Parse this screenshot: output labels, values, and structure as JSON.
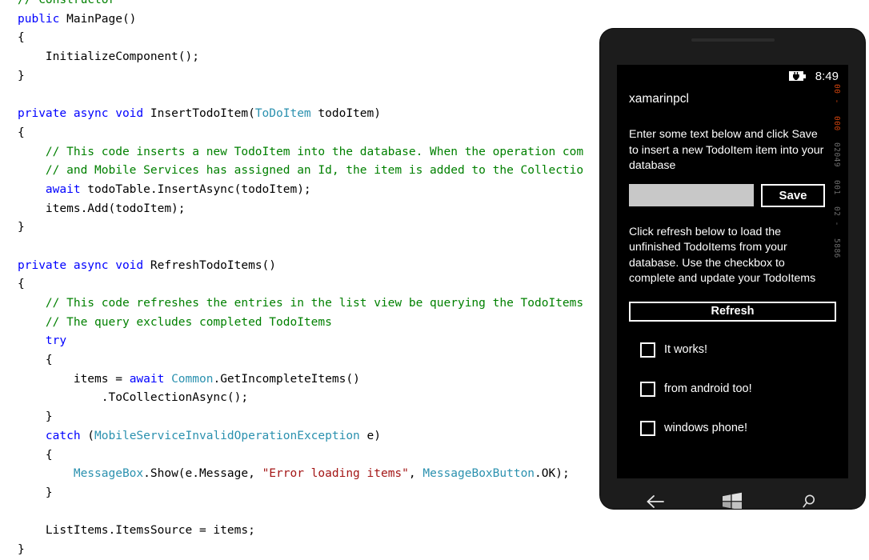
{
  "editor": {
    "language": "csharp",
    "code_lines": [
      [
        {
          "t": "// Constructor",
          "c": "cmt"
        }
      ],
      [
        {
          "t": "public ",
          "c": "kw"
        },
        {
          "t": "MainPage()",
          "c": "pln"
        }
      ],
      [
        {
          "t": "{",
          "c": "pln"
        }
      ],
      [
        {
          "t": "    InitializeComponent();",
          "c": "pln"
        }
      ],
      [
        {
          "t": "}",
          "c": "pln"
        }
      ],
      [],
      [
        {
          "t": "private async void ",
          "c": "kw"
        },
        {
          "t": "InsertTodoItem(",
          "c": "pln"
        },
        {
          "t": "ToDoItem",
          "c": "typ"
        },
        {
          "t": " todoItem)",
          "c": "pln"
        }
      ],
      [
        {
          "t": "{",
          "c": "pln"
        }
      ],
      [
        {
          "t": "    // This code inserts a new TodoItem into the database. When the operation com",
          "c": "cmt"
        }
      ],
      [
        {
          "t": "    // and Mobile Services has assigned an Id, the item is added to the Collectio",
          "c": "cmt"
        }
      ],
      [
        {
          "t": "    ",
          "c": "pln"
        },
        {
          "t": "await",
          "c": "kw"
        },
        {
          "t": " todoTable.InsertAsync(todoItem);",
          "c": "pln"
        }
      ],
      [
        {
          "t": "    items.Add(todoItem);",
          "c": "pln"
        }
      ],
      [
        {
          "t": "}",
          "c": "pln"
        }
      ],
      [],
      [
        {
          "t": "private async void ",
          "c": "kw"
        },
        {
          "t": "RefreshTodoItems()",
          "c": "pln"
        }
      ],
      [
        {
          "t": "{",
          "c": "pln"
        }
      ],
      [
        {
          "t": "    // This code refreshes the entries in the list view be querying the TodoItems",
          "c": "cmt"
        }
      ],
      [
        {
          "t": "    // The query excludes completed TodoItems",
          "c": "cmt"
        }
      ],
      [
        {
          "t": "    try",
          "c": "kw"
        }
      ],
      [
        {
          "t": "    {",
          "c": "pln"
        }
      ],
      [
        {
          "t": "        items = ",
          "c": "pln"
        },
        {
          "t": "await",
          "c": "kw"
        },
        {
          "t": " ",
          "c": "pln"
        },
        {
          "t": "Common",
          "c": "typ"
        },
        {
          "t": ".GetIncompleteItems()",
          "c": "pln"
        }
      ],
      [
        {
          "t": "            .ToCollectionAsync();",
          "c": "pln"
        }
      ],
      [
        {
          "t": "    }",
          "c": "pln"
        }
      ],
      [
        {
          "t": "    catch",
          "c": "kw"
        },
        {
          "t": " (",
          "c": "pln"
        },
        {
          "t": "MobileServiceInvalidOperationException",
          "c": "typ"
        },
        {
          "t": " e)",
          "c": "pln"
        }
      ],
      [
        {
          "t": "    {",
          "c": "pln"
        }
      ],
      [
        {
          "t": "        ",
          "c": "pln"
        },
        {
          "t": "MessageBox",
          "c": "typ"
        },
        {
          "t": ".Show(e.Message, ",
          "c": "pln"
        },
        {
          "t": "\"Error loading items\"",
          "c": "str"
        },
        {
          "t": ", ",
          "c": "pln"
        },
        {
          "t": "MessageBoxButton",
          "c": "typ"
        },
        {
          "t": ".OK);",
          "c": "pln"
        }
      ],
      [
        {
          "t": "    }",
          "c": "pln"
        }
      ],
      [],
      [
        {
          "t": "    ListItems.ItemsSource = items;",
          "c": "pln"
        }
      ],
      [
        {
          "t": "}",
          "c": "pln"
        }
      ]
    ],
    "colors": {
      "keyword": "#0000ff",
      "type": "#2b91af",
      "comment": "#008000",
      "string": "#a31515",
      "plain": "#000000",
      "background": "#ffffff"
    }
  },
  "phone": {
    "status_bar": {
      "battery_icon": "battery-charging-icon",
      "clock": "8:49"
    },
    "app": {
      "title": "xamarinpcl",
      "instruction_1": "Enter some text below and click Save to insert a new TodoItem item into your database",
      "instruction_2": "Click refresh below to load the unfinished TodoItems from your database. Use the checkbox to complete and update your TodoItems",
      "input_value": "",
      "input_placeholder": "",
      "save_label": "Save",
      "refresh_label": "Refresh",
      "todo_items": [
        {
          "label": "It works!",
          "checked": false
        },
        {
          "label": "from android too!",
          "checked": false
        },
        {
          "label": "windows phone!",
          "checked": false
        }
      ]
    },
    "perf_overlay": {
      "lines": [
        {
          "text": "00 -",
          "color": "#d1440e"
        },
        {
          "text": "000",
          "color": "#d1440e"
        },
        {
          "text": "02049",
          "color": "#6e6e6e"
        },
        {
          "text": "001",
          "color": "#6e6e6e"
        },
        {
          "text": "02 -",
          "color": "#6e6e6e"
        },
        {
          "text": "5886",
          "color": "#6e6e6e"
        }
      ]
    },
    "nav_bar": {
      "back_icon": "back-arrow-icon",
      "home_icon": "windows-logo-icon",
      "search_icon": "search-icon"
    },
    "colors": {
      "chassis": "#1c1c1c",
      "screen_bg": "#000000",
      "accent_text": "#ffffff",
      "input_bg": "#c8c8c8"
    }
  }
}
